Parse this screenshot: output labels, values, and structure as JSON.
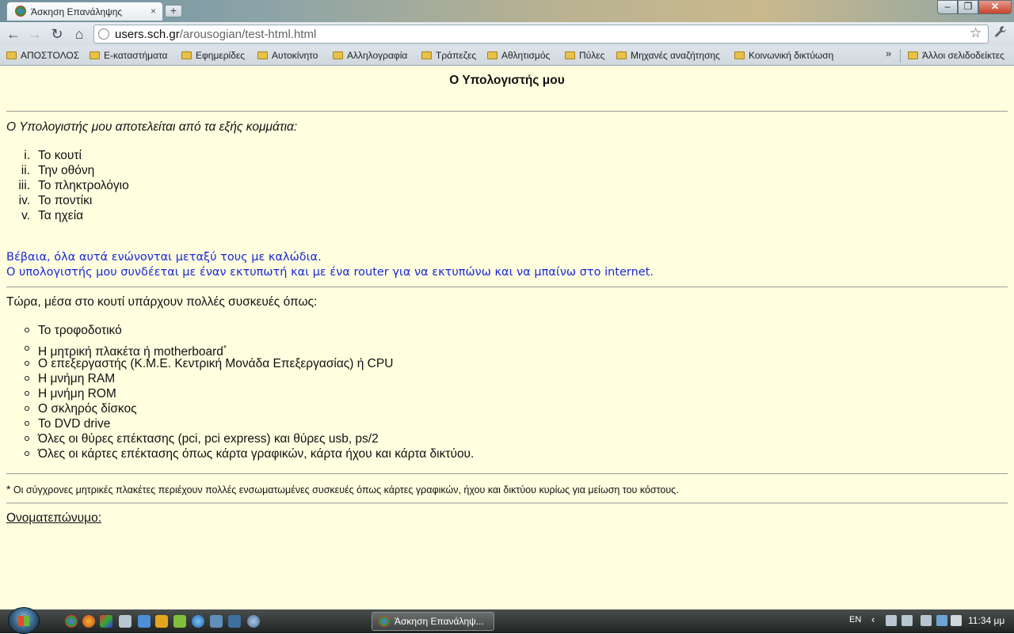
{
  "window": {
    "tab_title": "Άσκηση Επανάληψης",
    "tab_close": "×",
    "new_tab": "+",
    "minimize": "–",
    "maximize": "❐",
    "close": "✕"
  },
  "toolbar": {
    "back": "←",
    "forward": "→",
    "reload": "↻",
    "home": "⌂",
    "url_host": "users.sch.gr",
    "url_path": "/arousogian/test-html.html",
    "star": "☆",
    "wrench": "🔧"
  },
  "bookmarks": {
    "items": [
      "ΑΠΟΣΤΟΛΟΣ",
      "Ε-καταστήματα",
      "Εφημερίδες",
      "Αυτοκίνητο",
      "Αλληλογραφία",
      "Τράπεζες",
      "Αθλητισμός",
      "Πύλες",
      "Μηχανές αναζήτησης",
      "Κοινωνική δικτύωση"
    ],
    "more": "»",
    "other": "Άλλοι σελιδοδείκτες"
  },
  "page": {
    "heading": "Ο Υπολογιστής μου",
    "intro": "Ο Υπολογιστής μου αποτελείται από τα εξής κομμάτια:",
    "roman_items": [
      {
        "num": "i.",
        "text": "Το κουτί"
      },
      {
        "num": "ii.",
        "text": "Την οθόνη"
      },
      {
        "num": "iii.",
        "text": "Το πληκτρολόγιο"
      },
      {
        "num": "iv.",
        "text": "Το ποντίκι"
      },
      {
        "num": "v.",
        "text": "Τα ηχεία"
      }
    ],
    "blue_line1": "Βέβαια, όλα αυτά ενώνονται μεταξύ τους με καλώδια.",
    "blue_line2": "Ο υπολογιστής μου συνδέεται με έναν εκτυπωτή και με ένα router για να εκτυπώνω και να μπαίνω στο internet.",
    "now_text": "Τώρα, μέσα στο κουτί υπάρχουν πολλές συσκευές όπως:",
    "bullet_items": [
      "Το τροφοδοτικό",
      "Η μητρική πλακέτα ή motherboard",
      "Ο επεξεργαστής (Κ.Μ.Ε. Κεντρική Μονάδα Επεξεργασίας) ή CPU",
      "Η μνήμη RAM",
      "Η μνήμη ROM",
      "Ο σκληρός δίσκος",
      "Το DVD drive",
      "Όλες οι θύρες επέκτασης (pci, pci express) και θύρες usb, ps/2",
      "Όλες οι κάρτες επέκτασης όπως κάρτα γραφικών, κάρτα ήχου και κάρτα δικτύου."
    ],
    "motherboard_sup": "*",
    "footnote_mark": "*",
    "footnote": " Οι σύγχρονες μητρικές πλακέτες περιέχουν πολλές ενσωματωμένες συσκευές όπως κάρτες γραφικών, ήχου και δικτύου κυρίως για μείωση του κόστους.",
    "name_label": "Ονοματεπώνυμο:"
  },
  "taskbar": {
    "task_label": "Άσκηση Επανάληψ...",
    "lang": "EN",
    "tray_arrow": "‹",
    "clock": "11:34 μμ"
  }
}
